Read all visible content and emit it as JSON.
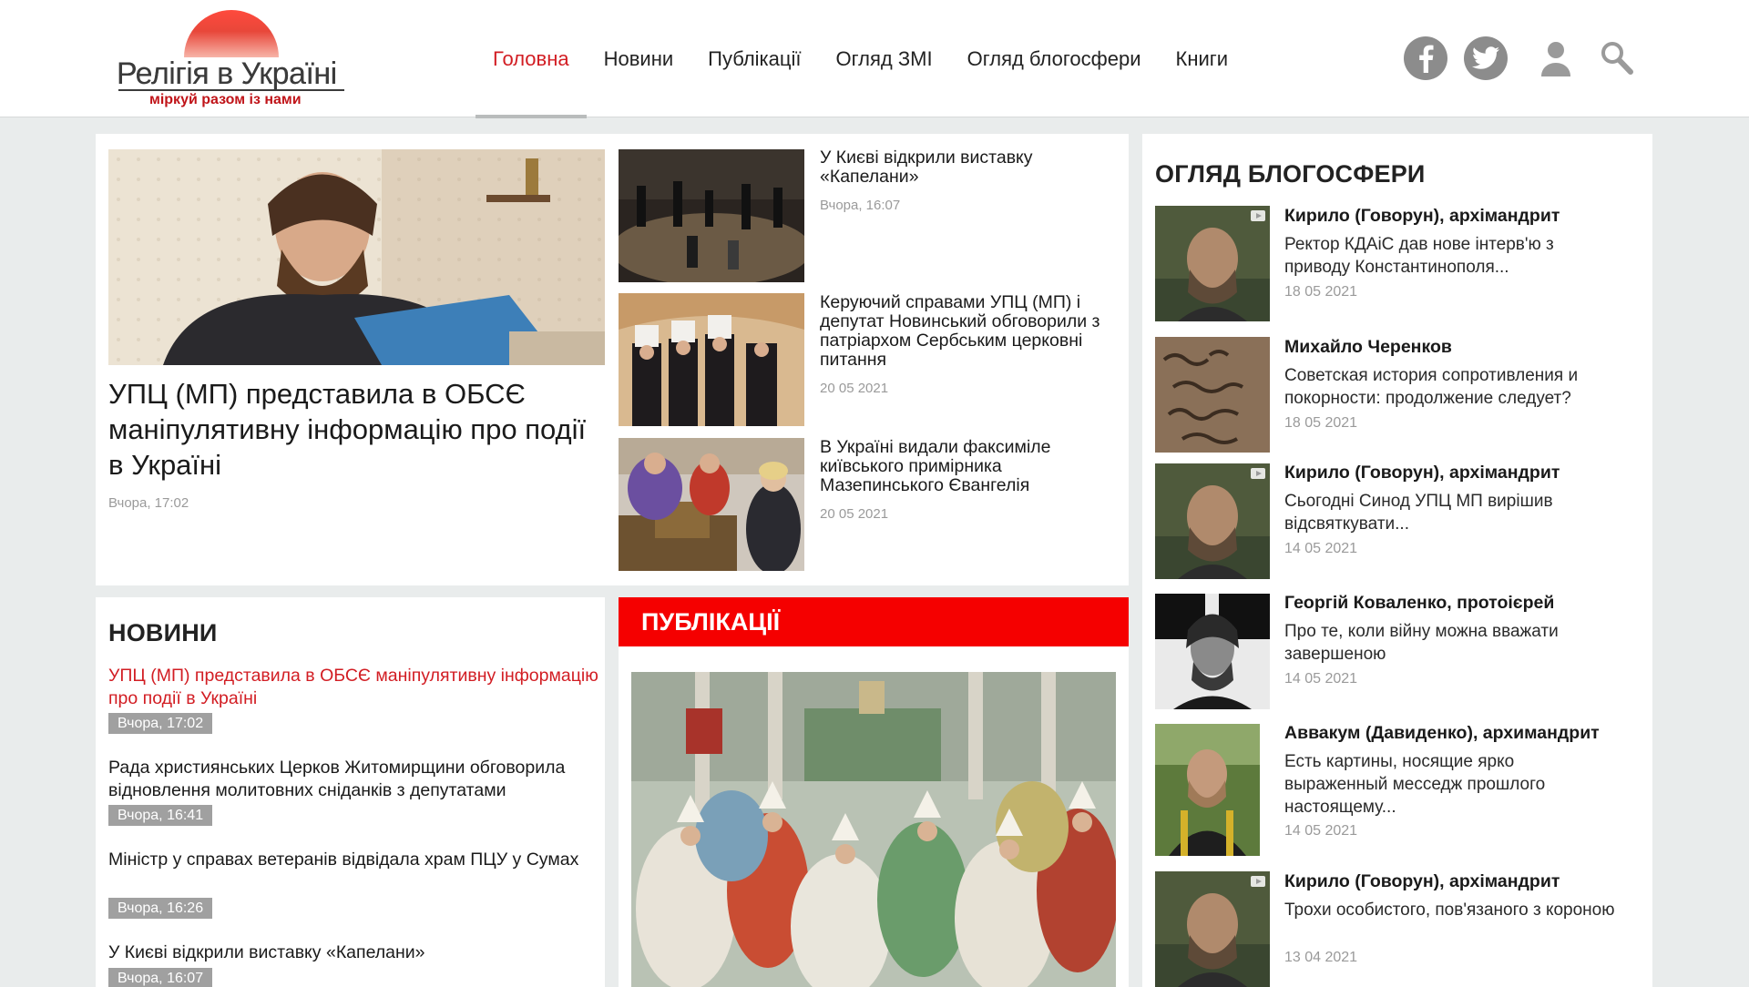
{
  "logo": {
    "title": "Релігія в Україні",
    "tagline": "міркуй разом із нами"
  },
  "nav": {
    "items": [
      {
        "label": "Головна",
        "active": true
      },
      {
        "label": "Новини"
      },
      {
        "label": "Публікації"
      },
      {
        "label": "Огляд ЗМІ"
      },
      {
        "label": "Огляд блогосфери"
      },
      {
        "label": "Книги"
      }
    ]
  },
  "header_icons": [
    "facebook-icon",
    "twitter-icon",
    "user-icon",
    "search-icon"
  ],
  "colors": {
    "accent": "#d21d23",
    "publications_bar": "#f50000",
    "date_badge": "#a0a0a0",
    "background": "#e9ecec"
  },
  "hero": {
    "title": "УПЦ (МП) представила в ОБСЄ маніпулятивну інформацію про події в Україні",
    "date": "Вчора, 17:02"
  },
  "side_stories": [
    {
      "title": "У Києві відкрили виставку «Капелани»",
      "date": "Вчора, 16:07"
    },
    {
      "title": "Керуючий справами УПЦ (МП) і депутат Новинський обговорили з патріархом Сербським церковні питання",
      "date": "20 05 2021"
    },
    {
      "title": "В Україні видали факсиміле київського примірника Мазепинського Євангелія",
      "date": "20 05 2021"
    }
  ],
  "news": {
    "heading": "НОВИНИ",
    "items": [
      {
        "title": "УПЦ (МП) представила в ОБСЄ маніпулятивну інформацію про події в Україні",
        "date": "Вчора, 17:02"
      },
      {
        "title": "Рада християнських Церков Житомирщини обговорила відновлення молитовних сніданків з депутатами",
        "date": "Вчора, 16:41"
      },
      {
        "title": "Міністр у справах ветеранів відвідала храм ПЦУ у Сумах",
        "date": "Вчора, 16:26"
      },
      {
        "title": "У Києві відкрили виставку «Капелани»",
        "date": "Вчора, 16:07"
      }
    ]
  },
  "publications": {
    "heading": "ПУБЛІКАЦІЇ"
  },
  "blogs": {
    "heading": "ОГЛЯД БЛОГОСФЕРИ",
    "items": [
      {
        "author": "Кирило (Говорун), архімандрит",
        "text": "Ректор КДАіС дав нове інтерв'ю з приводу Константинополя...",
        "date": "18 05 2021"
      },
      {
        "author": "Михайло Черенков",
        "text": "Советская история сопротивления и покорности: продолжение следует?",
        "date": "18 05 2021"
      },
      {
        "author": "Кирило (Говорун), архімандрит",
        "text": "Сьогодні Синод УПЦ МП вирішив відсвяткувати...",
        "date": "14 05 2021"
      },
      {
        "author": "Георгій Коваленко, протоієрей",
        "text": "Про те, коли війну можна вважати завершеною",
        "date": "14 05 2021"
      },
      {
        "author": "Аввакум (Давиденко), архимандрит",
        "text": "Есть картины, носящие ярко выраженный месседж прошлого настоящему...",
        "date": "14 05 2021"
      },
      {
        "author": "Кирило (Говорун), архімандрит",
        "text": "Трохи особистого, пов'язаного з короною",
        "date": "13 04 2021"
      }
    ]
  }
}
